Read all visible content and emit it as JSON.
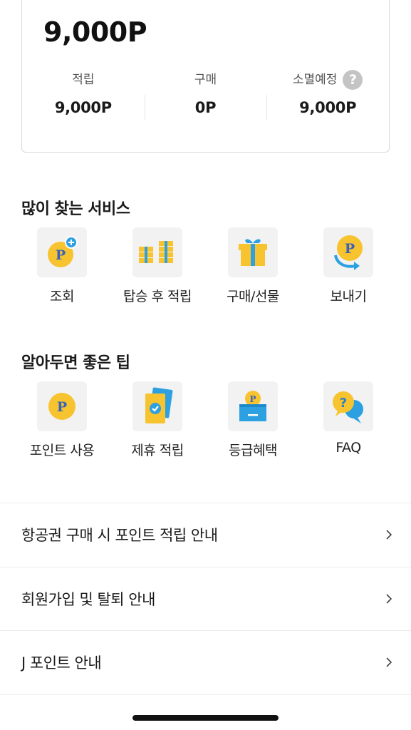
{
  "points_card": {
    "total": "9,000P",
    "stats": [
      {
        "label": "적립",
        "value": "9,000P"
      },
      {
        "label": "구매",
        "value": "0P"
      },
      {
        "label": "소멸예정",
        "value": "9,000P",
        "help": "?"
      }
    ]
  },
  "services": {
    "title": "많이 찾는 서비스",
    "items": [
      {
        "label": "조회",
        "icon": "point-coin-plus-icon"
      },
      {
        "label": "탑승 후 적립",
        "icon": "coin-stacks-icon"
      },
      {
        "label": "구매/선물",
        "icon": "gift-box-icon"
      },
      {
        "label": "보내기",
        "icon": "send-point-icon"
      }
    ]
  },
  "tips": {
    "title": "알아두면 좋은 팁",
    "items": [
      {
        "label": "포인트 사용",
        "icon": "point-coin-icon"
      },
      {
        "label": "제휴 적립",
        "icon": "partner-card-icon"
      },
      {
        "label": "등급혜택",
        "icon": "coin-wallet-icon"
      },
      {
        "label": "FAQ",
        "icon": "faq-bubble-icon"
      }
    ]
  },
  "info_list": [
    {
      "label": "항공권 구매 시 포인트 적립 안내"
    },
    {
      "label": "회원가입 및 탈퇴 안내"
    },
    {
      "label": "J 포인트 안내"
    }
  ],
  "colors": {
    "coin_yellow": "#f7c32e",
    "coin_text": "#3a63b8",
    "accent_blue": "#2ca0e0",
    "tile_bg": "#f2f2f2"
  }
}
